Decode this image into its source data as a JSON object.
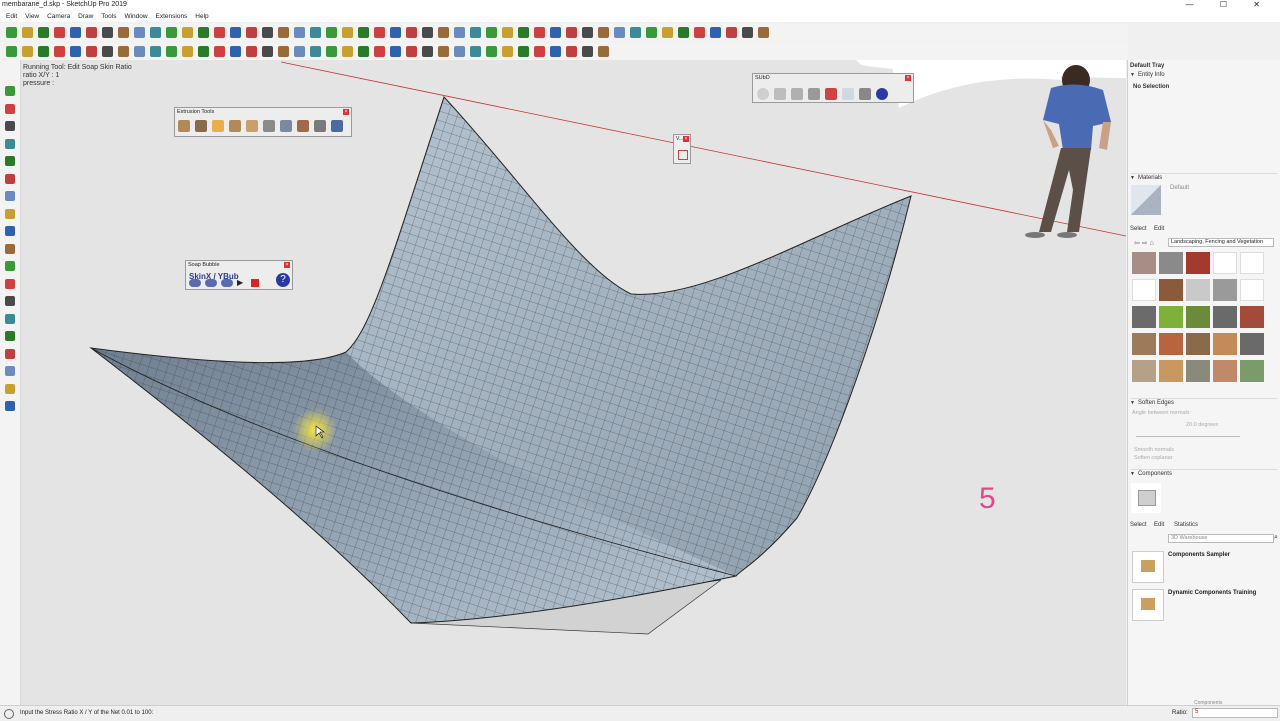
{
  "window": {
    "title": "membarane_d.skp - SketchUp Pro 2019",
    "controls": "—  ☐  ✕"
  },
  "menu": [
    "Edit",
    "View",
    "Camera",
    "Draw",
    "Tools",
    "Window",
    "Extensions",
    "Help"
  ],
  "vcb_info": {
    "line1": "Running Tool: Edit Soap Skin Ratio",
    "line2": "ratio X/Y : 1",
    "line3": "pressure :"
  },
  "palettes": {
    "extrusion": {
      "title": "Extrusion Tools"
    },
    "soap": {
      "title": "Soap Bubble",
      "label": "SkinX / YBub"
    },
    "subd": {
      "title": "SUbD"
    },
    "mini": {
      "title": "V..."
    }
  },
  "tray": {
    "title": "Default Tray",
    "entity_info": {
      "header": "Entity Info",
      "selection": "No Selection"
    },
    "materials": {
      "header": "Materials",
      "current": "Default",
      "tabs": [
        "Select",
        "Edit"
      ],
      "library": "Landscaping, Fencing and Vegetation",
      "swatch_colors": [
        "#a88c86",
        "#8a8a8a",
        "#a23a2e",
        "#ffffff",
        "#ffffff",
        "#ffffff",
        "#8a5a3a",
        "#c9c9c9",
        "#9a9a9a",
        "#ffffff",
        "#6b6b6b",
        "#7fb13a",
        "#6b8a3a",
        "#6a6a6a",
        "#a44a3a",
        "#9c7a5a",
        "#b8643e",
        "#8a6a4a",
        "#c48a5a",
        "#6a6a6a",
        "#b5a088",
        "#c99860",
        "#8a8a7a",
        "#c08a6a",
        "#7a9c6a"
      ]
    },
    "soften": {
      "header": "Soften Edges",
      "angle_label": "Angle between normals:",
      "angle_value": "20.0  degrees",
      "opt1": "Smooth normals",
      "opt2": "Soften coplanar"
    },
    "components": {
      "header": "Components",
      "tabs": [
        "Select",
        "Edit",
        "Statistics"
      ],
      "search": "3D Warehouse",
      "items": [
        {
          "title": "Components Sampler"
        },
        {
          "title": "Dynamic Components Training"
        }
      ],
      "footer": "Components"
    }
  },
  "overlay_number": "5",
  "status": {
    "hint": "Input the Stress Ratio X / Y  of the Net 0.01 to 100:",
    "ratio_label": "Ratio:",
    "ratio_value": "5"
  },
  "colors": {
    "accent_pink": "#e4468c",
    "mesh_face": "#aebdcb",
    "axis_red": "#c83232"
  }
}
